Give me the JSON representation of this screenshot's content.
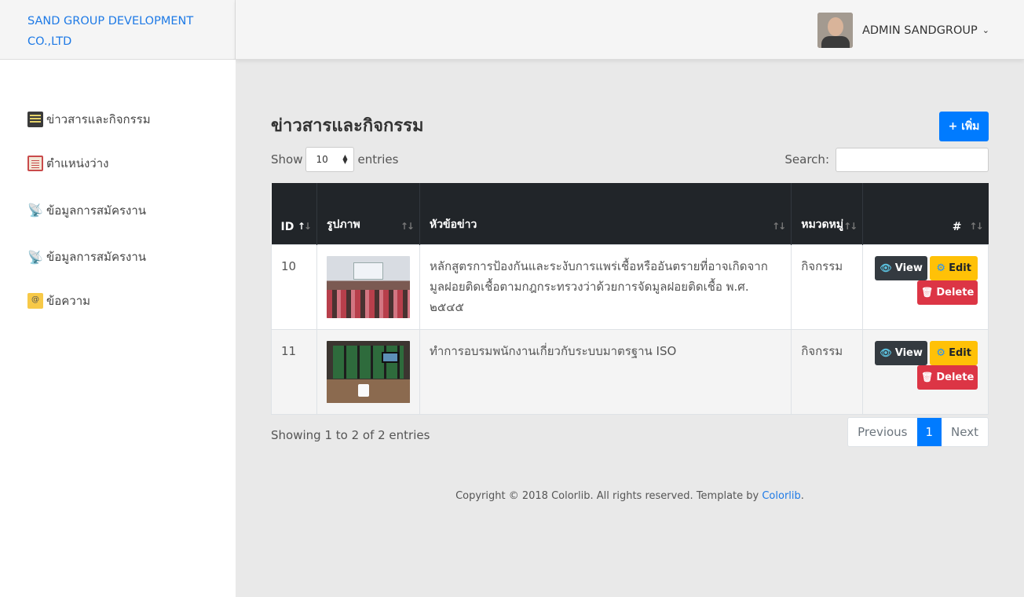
{
  "brand": {
    "line1": "SAND GROUP DEVELOPMENT",
    "line2": "CO.,LTD"
  },
  "user": {
    "name": "ADMIN SANDGROUP",
    "avatar_icon": "user-avatar"
  },
  "sidebar": {
    "items": [
      {
        "label": "ข่าวสารและกิจกรรม",
        "icon": "newspaper-icon"
      },
      {
        "label": "ตำแหน่งว่าง",
        "icon": "clipboard-icon"
      },
      {
        "label": "ข้อมูลการสมัครงาน",
        "icon": "satellite-icon"
      },
      {
        "label": "ข้อมูลการสมัครงาน",
        "icon": "satellite-icon"
      },
      {
        "label": "ข้อความ",
        "icon": "email-icon"
      }
    ]
  },
  "main": {
    "title": "ข่าวสารและกิจกรรม",
    "add_button": "+ เพิ่ม",
    "show_label": "Show",
    "entries_label": "entries",
    "page_length": "10",
    "search_label": "Search:",
    "search_value": "",
    "columns": [
      "ID",
      "รูปภาพ",
      "หัวข้อข่าว",
      "หมวดหมู่",
      "#"
    ],
    "rows": [
      {
        "id": "10",
        "title": "หลักสูตรการป้องกันและระงับการแพร่เชื้อหรืออันตรายที่อาจเกิดจากมูลฝอยติดเชื้อตามกฎกระทรวงว่าด้วยการจัดมูลฝอยติดเชื้อ พ.ศ. ๒๕๔๕",
        "category": "กิจกรรม"
      },
      {
        "id": "11",
        "title": "ทำการอบรมพนักงานเกี่ยวกับระบบมาตรฐาน ISO",
        "category": "กิจกรรม"
      }
    ],
    "actions": {
      "view": "View",
      "edit": "Edit",
      "delete": "Delete"
    },
    "info": "Showing 1 to 2 of 2 entries",
    "pagination": {
      "previous": "Previous",
      "current": "1",
      "next": "Next"
    }
  },
  "footer": {
    "text": "Copyright © 2018 Colorlib. All rights reserved. Template by ",
    "link": "Colorlib",
    "tail": "."
  },
  "colors": {
    "accent": "#007bff",
    "brand": "#1e7ae6",
    "danger": "#dc3545",
    "warning": "#ffc107",
    "dark": "#212529"
  }
}
